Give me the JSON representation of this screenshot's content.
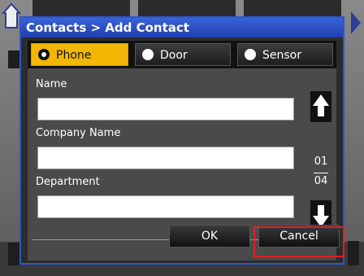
{
  "dialog": {
    "title": "Contacts > Add Contact"
  },
  "type_tabs": [
    {
      "label": "Phone",
      "selected": true
    },
    {
      "label": "Door",
      "selected": false
    },
    {
      "label": "Sensor",
      "selected": false
    }
  ],
  "fields": [
    {
      "label": "Name",
      "value": ""
    },
    {
      "label": "Company Name",
      "value": ""
    },
    {
      "label": "Department",
      "value": ""
    }
  ],
  "pagination": {
    "current": "01",
    "total": "04"
  },
  "buttons": {
    "ok": "OK",
    "cancel": "Cancel"
  },
  "colors": {
    "title_bar": "#2f55c9",
    "selected_tab": "#f2b705",
    "highlight": "#e0202a"
  },
  "icons": {
    "home": "home-icon",
    "scroll_up": "arrow-up-icon",
    "scroll_down": "arrow-down-icon"
  }
}
